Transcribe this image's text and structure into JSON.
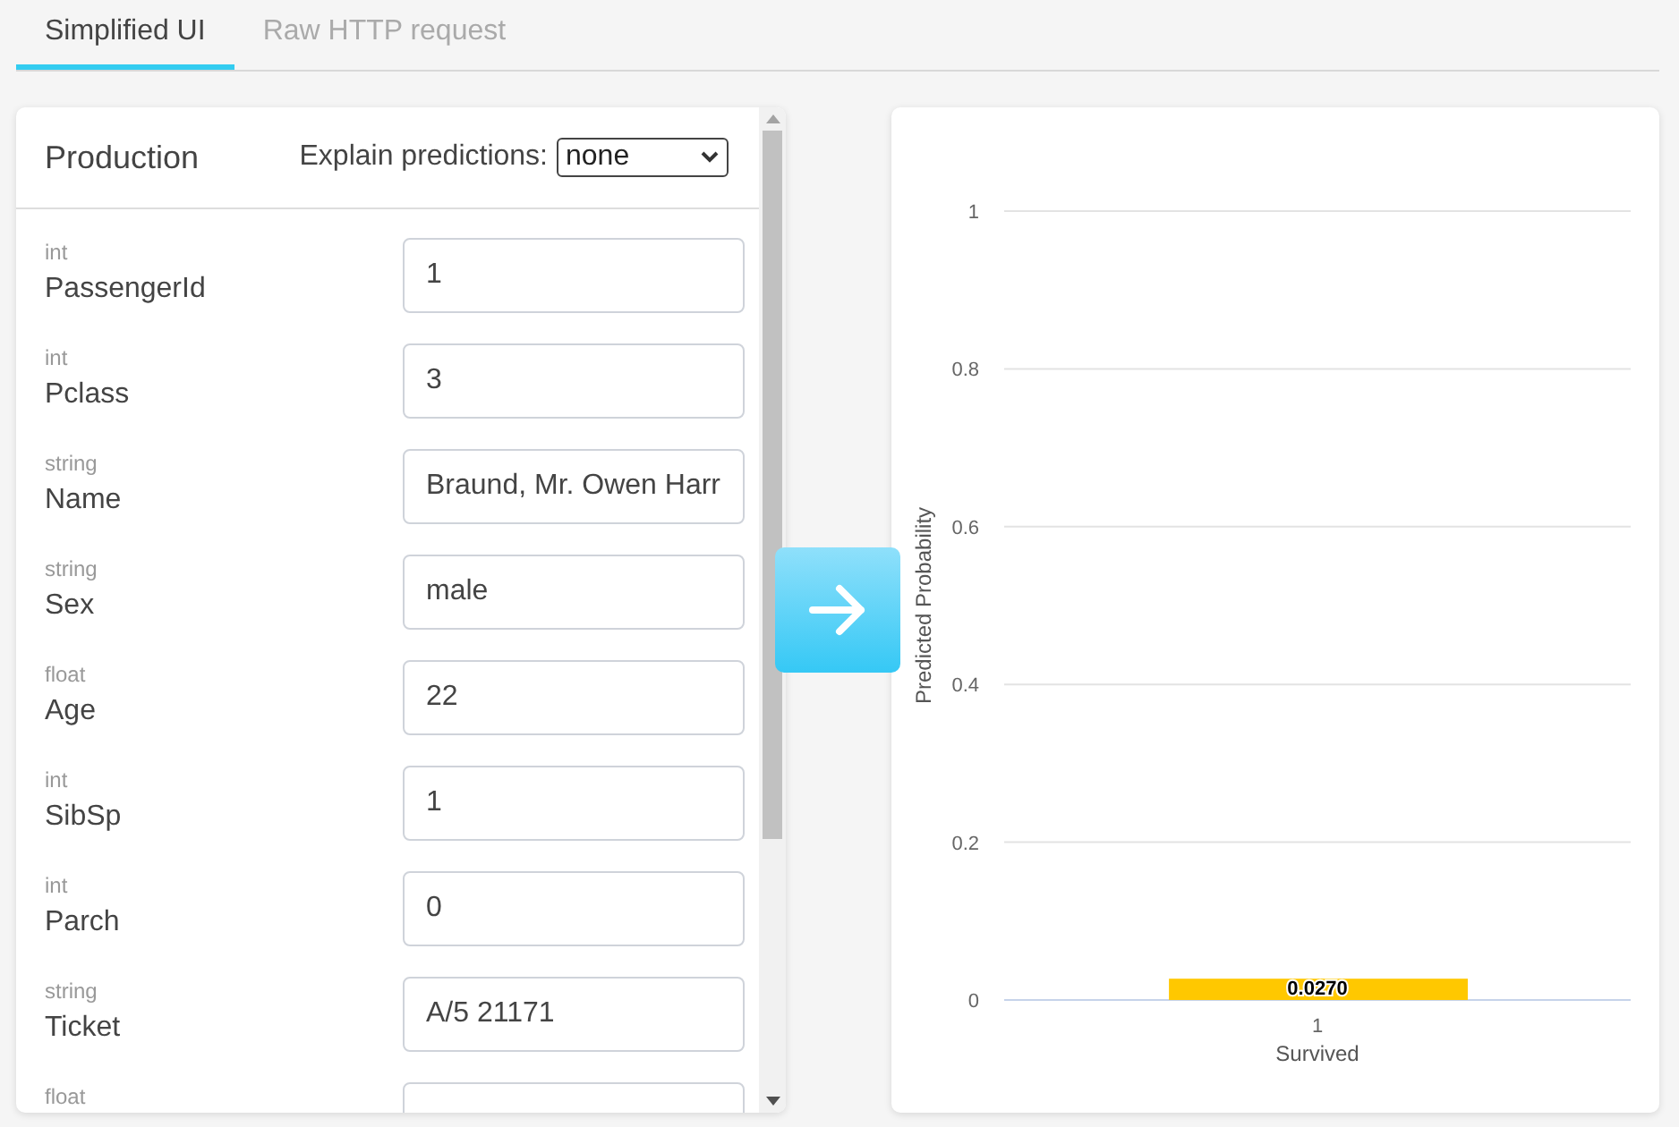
{
  "tabs": [
    {
      "label": "Simplified UI",
      "selected": true
    },
    {
      "label": "Raw HTTP request",
      "selected": false
    }
  ],
  "form": {
    "title": "Production",
    "explain_label": "Explain predictions:",
    "explain_value": "none",
    "fields": [
      {
        "type": "int",
        "name": "PassengerId",
        "value": "1"
      },
      {
        "type": "int",
        "name": "Pclass",
        "value": "3"
      },
      {
        "type": "string",
        "name": "Name",
        "value": "Braund, Mr. Owen Harr"
      },
      {
        "type": "string",
        "name": "Sex",
        "value": "male"
      },
      {
        "type": "float",
        "name": "Age",
        "value": "22"
      },
      {
        "type": "int",
        "name": "SibSp",
        "value": "1"
      },
      {
        "type": "int",
        "name": "Parch",
        "value": "0"
      },
      {
        "type": "string",
        "name": "Ticket",
        "value": "A/5 21171"
      },
      {
        "type": "float"
      }
    ]
  },
  "result": {
    "chart_data": {
      "type": "bar",
      "xlabel": "Survived",
      "ylabel": "Predicted Probability",
      "categories": [
        "1"
      ],
      "values": [
        0.027
      ],
      "ylim": [
        0,
        1
      ],
      "yticks": [
        0,
        0.2,
        0.4,
        0.6,
        0.8,
        1
      ],
      "value_labels": [
        "0.0270"
      ],
      "grid": true
    }
  }
}
